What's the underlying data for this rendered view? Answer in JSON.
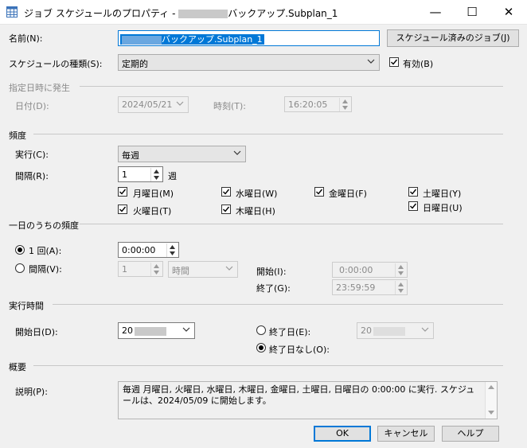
{
  "window": {
    "title_prefix": "ジョブ スケジュールのプロパティ - ",
    "title_suffix": "バックアップ.Subplan_1",
    "minimize_glyph": "—",
    "maximize_glyph": "☐",
    "close_glyph": "✕"
  },
  "name": {
    "label": "名前(N):",
    "value_suffix": "バックアップ.Subplan_1",
    "jobs_button": "スケジュール済みのジョブ(J)"
  },
  "schedule_type": {
    "label": "スケジュールの種類(S):",
    "value": "定期的",
    "enabled_label": "有効(B)",
    "enabled": true
  },
  "one_time": {
    "header": "指定日時に発生",
    "date_label": "日付(D):",
    "date_value": "2024/05/21",
    "time_label": "時刻(T):",
    "time_value": "16:20:05"
  },
  "frequency": {
    "header": "頻度",
    "occurs_label": "実行(C):",
    "occurs_value": "毎週",
    "recurs_label": "間隔(R):",
    "recurs_value": "1",
    "recurs_unit": "週",
    "days": {
      "mon": {
        "label": "月曜日(M)",
        "checked": true
      },
      "tue": {
        "label": "火曜日(T)",
        "checked": true
      },
      "wed": {
        "label": "水曜日(W)",
        "checked": true
      },
      "thu": {
        "label": "木曜日(H)",
        "checked": true
      },
      "fri": {
        "label": "金曜日(F)",
        "checked": true
      },
      "sat": {
        "label": "土曜日(Y)",
        "checked": true
      },
      "sun": {
        "label": "日曜日(U)",
        "checked": true
      }
    }
  },
  "daily": {
    "header": "一日のうちの頻度",
    "once_label": "1 回(A):",
    "once_value": "0:00:00",
    "every_label": "間隔(V):",
    "every_value": "1",
    "every_unit": "時間",
    "start_label": "開始(I):",
    "start_value": "0:00:00",
    "end_label": "終了(G):",
    "end_value": "23:59:59",
    "selected": "once"
  },
  "duration": {
    "header": "実行時間",
    "start_label": "開始日(D):",
    "start_value_prefix": "20",
    "end_date_label": "終了日(E):",
    "end_date_value_prefix": "20",
    "no_end_label": "終了日なし(O):",
    "selected": "no_end"
  },
  "summary": {
    "header": "概要",
    "desc_label": "説明(P):",
    "desc_text": "毎週 月曜日, 火曜日, 水曜日, 木曜日, 金曜日, 土曜日, 日曜日の 0:00:00 に実行. スケジュールは、2024/05/09 に開始します。"
  },
  "buttons": {
    "ok": "OK",
    "cancel": "キャンセル",
    "help": "ヘルプ"
  },
  "colors": {
    "accent": "#0078d7",
    "dialog_bg": "#f0f0f0"
  }
}
